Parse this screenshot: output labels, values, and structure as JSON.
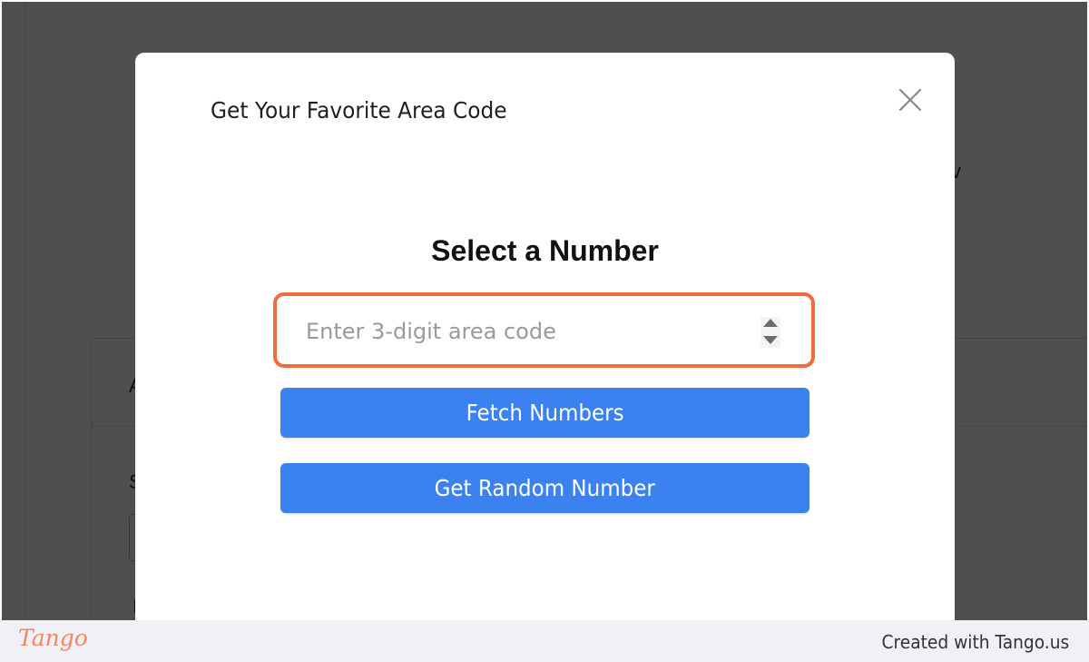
{
  "background": {
    "fragments": [
      "A",
      "S",
      "I",
      "v"
    ]
  },
  "modal": {
    "title": "Get Your Favorite Area Code",
    "close_icon": "close-icon",
    "heading": "Select a Number",
    "area_input": {
      "value": "",
      "placeholder": "Enter 3-digit area code"
    },
    "fetch_button": "Fetch Numbers",
    "random_button": "Get Random Number",
    "highlight_color": "#f26c3b",
    "button_color": "#3b82f0"
  },
  "footer": {
    "logo": "Tango",
    "credit": "Created with Tango.us"
  }
}
